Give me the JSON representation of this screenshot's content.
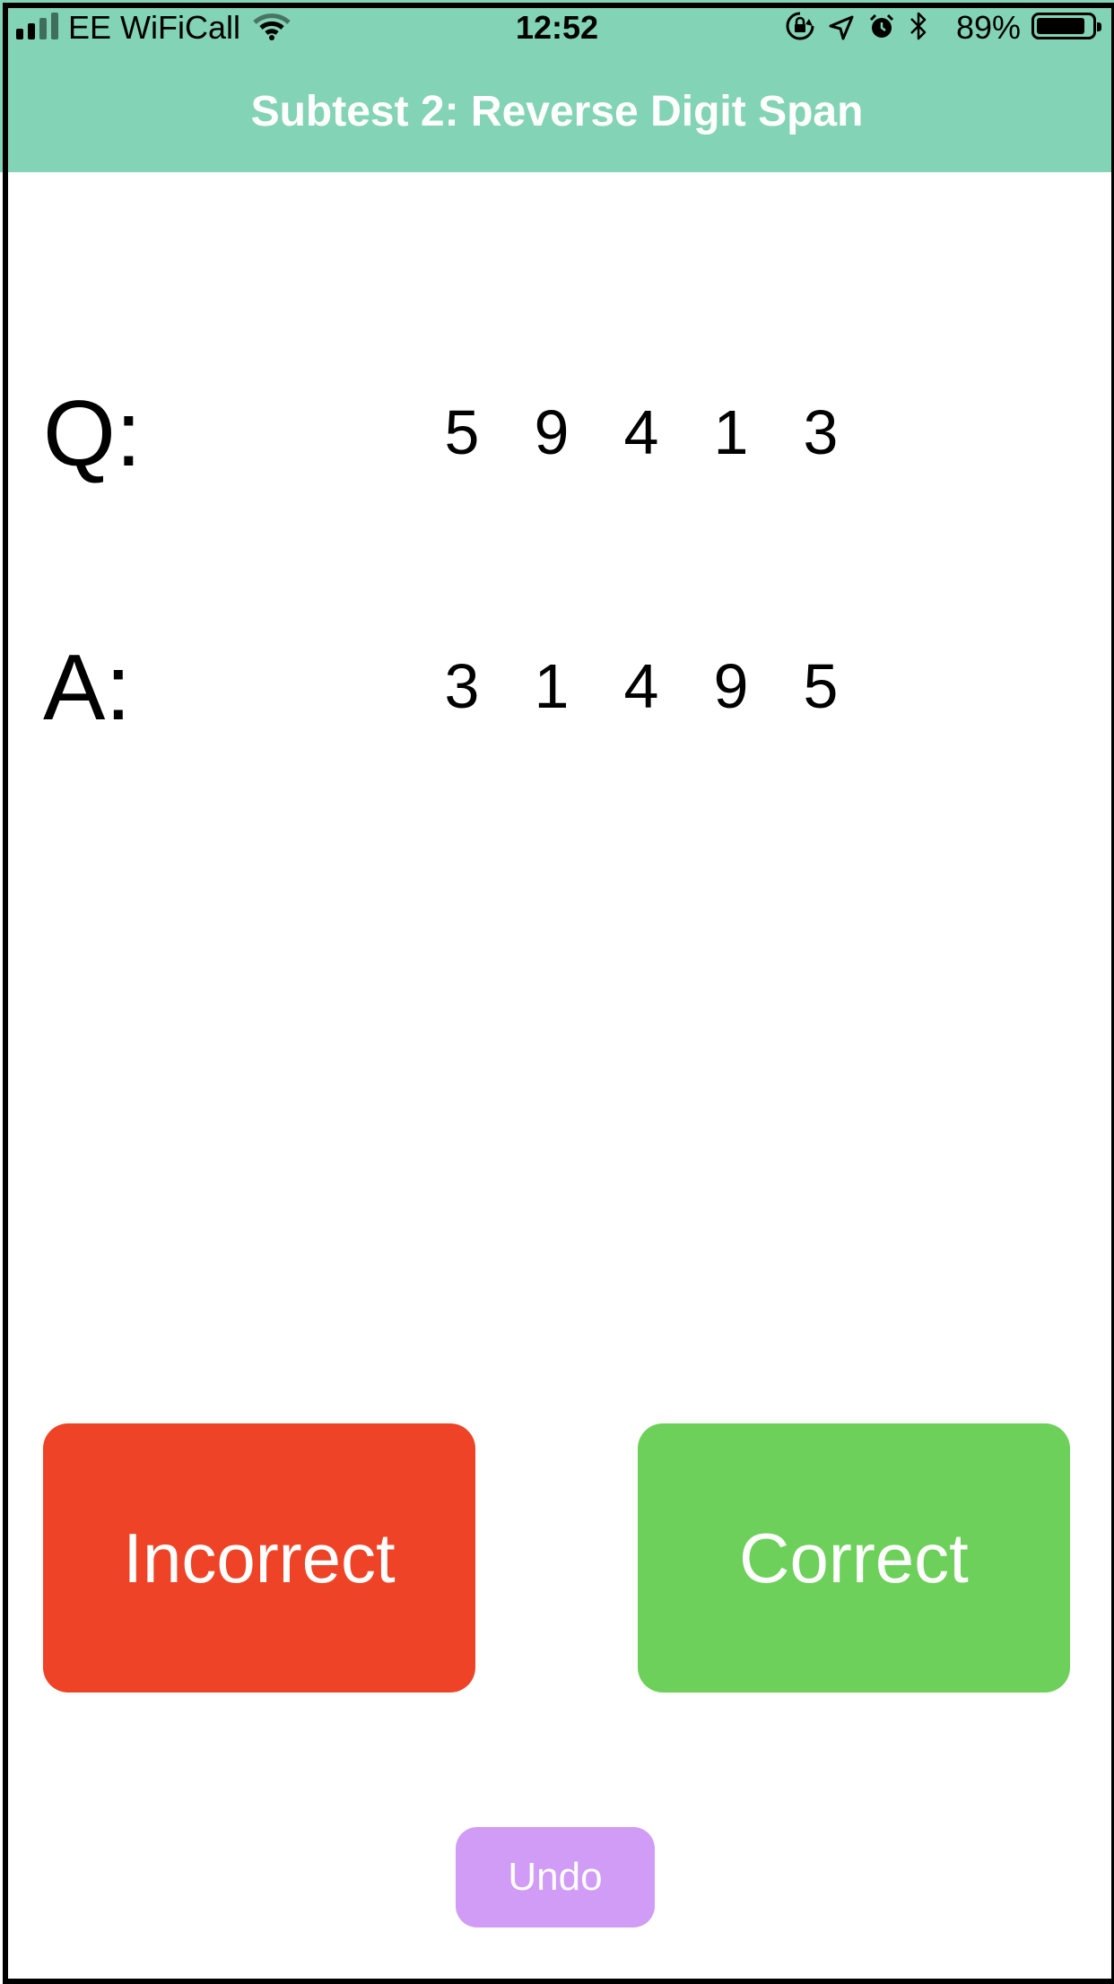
{
  "status_bar": {
    "carrier": "EE WiFiCall",
    "time": "12:52",
    "battery_percent": "89%",
    "signal_bars_filled": 2,
    "signal_bars_total": 4,
    "icons": [
      "wifi-icon",
      "orientation-lock-icon",
      "location-icon",
      "alarm-icon",
      "bluetooth-icon",
      "battery-icon"
    ]
  },
  "header": {
    "title": "Subtest 2: Reverse Digit Span",
    "background_color": "#83d3b6"
  },
  "question": {
    "label": "Q:",
    "digits": [
      "5",
      "9",
      "4",
      "1",
      "3"
    ]
  },
  "answer": {
    "label": "A:",
    "digits": [
      "3",
      "1",
      "4",
      "9",
      "5"
    ]
  },
  "buttons": {
    "incorrect": {
      "label": "Incorrect",
      "color": "#ee4326"
    },
    "correct": {
      "label": "Correct",
      "color": "#6dd05a"
    },
    "undo": {
      "label": "Undo",
      "color": "#d09cf5"
    }
  }
}
